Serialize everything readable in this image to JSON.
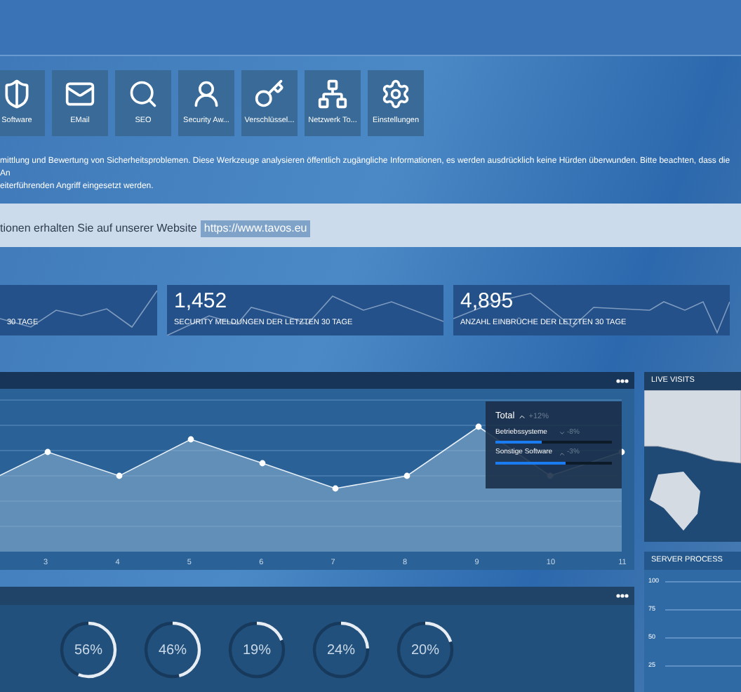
{
  "tools": [
    {
      "label": "Software"
    },
    {
      "label": "EMail"
    },
    {
      "label": "SEO"
    },
    {
      "label": "Security Aw..."
    },
    {
      "label": "Verschlüssel..."
    },
    {
      "label": "Netzwerk To..."
    },
    {
      "label": "Einstellungen"
    }
  ],
  "description": [
    "mittlung und Bewertung von Sicherheitsproblemen. Diese Werkzeuge analysieren öffentlich zugängliche Informationen, es werden ausdrücklich keine Hürden überwunden. Bitte beachten, dass die An",
    "eiterführenden Angriff eingesetzt werden."
  ],
  "info_band": {
    "text": "tionen erhalten Sie auf unserer Website",
    "link": "https://www.tavos.eu"
  },
  "stats": [
    {
      "label": "30 TAGE"
    },
    {
      "value": "1,452",
      "label": "SECURITY MELDUNGEN DER LETZTEN 30 TAGE"
    },
    {
      "value": "4,895",
      "label": "ANZAHL EINBRÜCHE DER LETZTEN 30 TAGE"
    }
  ],
  "main_chart": {
    "x_labels": [
      "3",
      "4",
      "5",
      "6",
      "7",
      "8",
      "9",
      "10",
      "11"
    ],
    "legend": {
      "title": "Total",
      "rising": true,
      "change": "+12%",
      "rows": [
        {
          "name": "Betriebssysteme",
          "rising": false,
          "change": "-8%",
          "level": 0.4
        },
        {
          "name": "Sonstige Software",
          "rising": true,
          "change": "-3%",
          "level": 0.6
        }
      ]
    }
  },
  "live_visits": {
    "title": "LIVE VISITS"
  },
  "server_process": {
    "title": "SERVER PROCESS",
    "y_ticks": [
      "100",
      "75",
      "50",
      "25"
    ]
  },
  "gauges": [
    {
      "reading": "56%",
      "level": 0.56
    },
    {
      "reading": "46%",
      "level": 0.46
    },
    {
      "reading": "19%",
      "level": 0.19
    },
    {
      "reading": "24%",
      "level": 0.24
    },
    {
      "reading": "20%",
      "level": 0.2
    }
  ]
}
